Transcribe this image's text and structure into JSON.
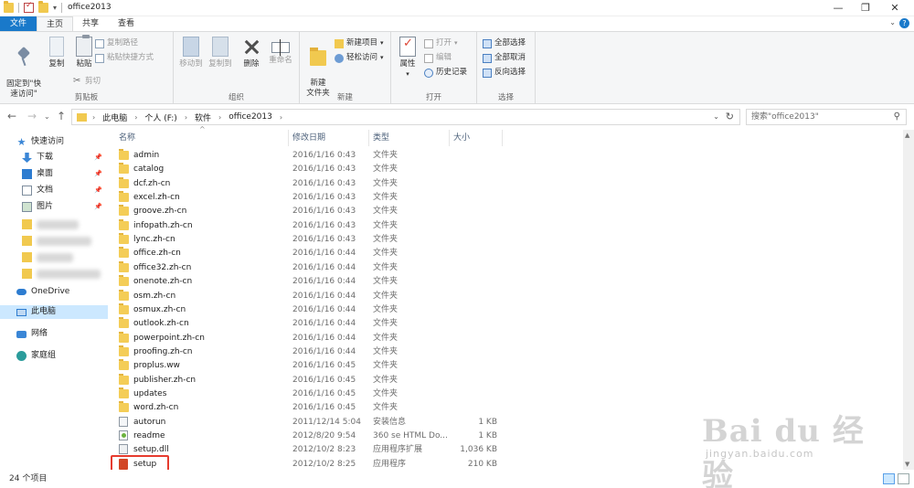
{
  "window": {
    "title": "office2013",
    "controls": {
      "minimize": "—",
      "maximize": "❐",
      "close": "✕"
    }
  },
  "ribbon": {
    "tabs": [
      {
        "label": "文件",
        "active": false
      },
      {
        "label": "主页",
        "active": true
      },
      {
        "label": "共享",
        "active": false
      },
      {
        "label": "查看",
        "active": false
      }
    ],
    "groups": {
      "clipboard": {
        "label": "剪贴板",
        "pin_quick_access": "固定到\"快\n速访问\"",
        "copy": "复制",
        "paste": "粘贴",
        "copy_path": "复制路径",
        "paste_shortcut": "粘贴快捷方式",
        "cut": "剪切"
      },
      "organize": {
        "label": "组织",
        "move_to": "移动到",
        "copy_to": "复制到",
        "delete": "删除",
        "rename": "重命名"
      },
      "new": {
        "label": "新建",
        "new_folder": "新建\n文件夹",
        "new_item": "新建项目",
        "easy_access": "轻松访问"
      },
      "open": {
        "label": "打开",
        "properties": "属性",
        "open": "打开",
        "edit": "编辑",
        "history": "历史记录"
      },
      "select": {
        "label": "选择",
        "select_all": "全部选择",
        "select_none": "全部取消",
        "invert": "反向选择"
      }
    }
  },
  "address": {
    "crumbs": [
      "此电脑",
      "个人 (F:)",
      "软件",
      "office2013"
    ],
    "search_placeholder": "搜索\"office2013\""
  },
  "nav": {
    "quick_access": "快速访问",
    "items": [
      {
        "label": "下载",
        "icon": "download-icon"
      },
      {
        "label": "桌面",
        "icon": "desktop-icon"
      },
      {
        "label": "文档",
        "icon": "documents-icon"
      },
      {
        "label": "图片",
        "icon": "pictures-icon"
      }
    ],
    "onedrive": "OneDrive",
    "this_pc": "此电脑",
    "network": "网络",
    "homegroup": "家庭组"
  },
  "columns": {
    "name": "名称",
    "date": "修改日期",
    "type": "类型",
    "size": "大小"
  },
  "files": [
    {
      "name": "admin",
      "date": "2016/1/16 0:43",
      "type": "文件夹",
      "size": "",
      "icon": "folder"
    },
    {
      "name": "catalog",
      "date": "2016/1/16 0:43",
      "type": "文件夹",
      "size": "",
      "icon": "folder"
    },
    {
      "name": "dcf.zh-cn",
      "date": "2016/1/16 0:43",
      "type": "文件夹",
      "size": "",
      "icon": "folder"
    },
    {
      "name": "excel.zh-cn",
      "date": "2016/1/16 0:43",
      "type": "文件夹",
      "size": "",
      "icon": "folder"
    },
    {
      "name": "groove.zh-cn",
      "date": "2016/1/16 0:43",
      "type": "文件夹",
      "size": "",
      "icon": "folder"
    },
    {
      "name": "infopath.zh-cn",
      "date": "2016/1/16 0:43",
      "type": "文件夹",
      "size": "",
      "icon": "folder"
    },
    {
      "name": "lync.zh-cn",
      "date": "2016/1/16 0:43",
      "type": "文件夹",
      "size": "",
      "icon": "folder"
    },
    {
      "name": "office.zh-cn",
      "date": "2016/1/16 0:44",
      "type": "文件夹",
      "size": "",
      "icon": "folder"
    },
    {
      "name": "office32.zh-cn",
      "date": "2016/1/16 0:44",
      "type": "文件夹",
      "size": "",
      "icon": "folder"
    },
    {
      "name": "onenote.zh-cn",
      "date": "2016/1/16 0:44",
      "type": "文件夹",
      "size": "",
      "icon": "folder"
    },
    {
      "name": "osm.zh-cn",
      "date": "2016/1/16 0:44",
      "type": "文件夹",
      "size": "",
      "icon": "folder"
    },
    {
      "name": "osmux.zh-cn",
      "date": "2016/1/16 0:44",
      "type": "文件夹",
      "size": "",
      "icon": "folder"
    },
    {
      "name": "outlook.zh-cn",
      "date": "2016/1/16 0:44",
      "type": "文件夹",
      "size": "",
      "icon": "folder"
    },
    {
      "name": "powerpoint.zh-cn",
      "date": "2016/1/16 0:44",
      "type": "文件夹",
      "size": "",
      "icon": "folder"
    },
    {
      "name": "proofing.zh-cn",
      "date": "2016/1/16 0:44",
      "type": "文件夹",
      "size": "",
      "icon": "folder"
    },
    {
      "name": "proplus.ww",
      "date": "2016/1/16 0:45",
      "type": "文件夹",
      "size": "",
      "icon": "folder"
    },
    {
      "name": "publisher.zh-cn",
      "date": "2016/1/16 0:45",
      "type": "文件夹",
      "size": "",
      "icon": "folder"
    },
    {
      "name": "updates",
      "date": "2016/1/16 0:45",
      "type": "文件夹",
      "size": "",
      "icon": "folder"
    },
    {
      "name": "word.zh-cn",
      "date": "2016/1/16 0:45",
      "type": "文件夹",
      "size": "",
      "icon": "folder"
    },
    {
      "name": "autorun",
      "date": "2011/12/14 5:04",
      "type": "安装信息",
      "size": "1 KB",
      "icon": "ini"
    },
    {
      "name": "readme",
      "date": "2012/8/20 9:54",
      "type": "360 se HTML Do...",
      "size": "1 KB",
      "icon": "htm"
    },
    {
      "name": "setup.dll",
      "date": "2012/10/2 8:23",
      "type": "应用程序扩展",
      "size": "1,036 KB",
      "icon": "dll"
    },
    {
      "name": "setup",
      "date": "2012/10/2 8:25",
      "type": "应用程序",
      "size": "210 KB",
      "icon": "office"
    }
  ],
  "status": {
    "item_count": "24 个项目"
  },
  "watermark": {
    "brand": "Bai du 经验",
    "url": "jingyan.baidu.com"
  },
  "colors": {
    "accent": "#1979ca",
    "highlight": "#e63b2e",
    "selection": "#cce8ff"
  }
}
